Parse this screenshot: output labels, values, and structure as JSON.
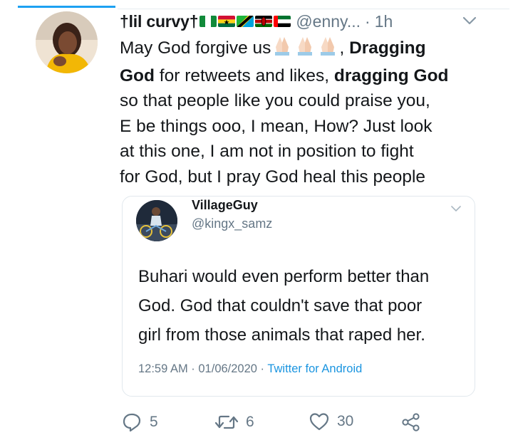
{
  "tweet": {
    "display_name": "†lil curvy†",
    "flags": [
      "flag-nigeria-icon",
      "flag-ghana-icon",
      "flag-tanzania-icon",
      "flag-kenya-icon",
      "flag-uae-icon"
    ],
    "handle": "@enny...",
    "separator": "·",
    "time": "1h",
    "text": {
      "line1_a": "May God forgive us",
      "line1_b": ", ",
      "line1_bold": "Dragging",
      "line2_bold": "God",
      "line2_a": " for retweets and likes, ",
      "line2_bold2": "dragging God",
      "line3": "so that people like you could praise you,",
      "line4": "E be things ooo, I mean, How? Just look",
      "line5": "at this one, I am not in position to fight",
      "line6": "for God, but I pray God heal this people"
    }
  },
  "quoted": {
    "name": "VillageGuy",
    "handle": "@kingx_samz",
    "line1": "Buhari would even perform better than",
    "line2": "God. God that couldn't save that poor",
    "line3": "girl from those animals that raped her.",
    "time": "12:59 AM · 01/06/2020 · ",
    "source": "Twitter for Android"
  },
  "actions": {
    "replies": "5",
    "retweets": "6",
    "likes": "30"
  },
  "colors": {
    "accent": "#1da1f2",
    "secondary_text": "#657786",
    "link": "#1b95e0"
  }
}
